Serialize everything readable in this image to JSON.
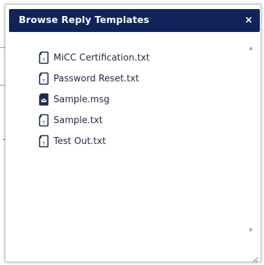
{
  "dialog": {
    "title": "Browse Reply Templates",
    "close_label": "×"
  },
  "files": [
    {
      "name": "MiCC Certification.txt",
      "icon": "text-file-icon"
    },
    {
      "name": "Password Reset.txt",
      "icon": "text-file-icon"
    },
    {
      "name": "Sample.msg",
      "icon": "message-file-icon"
    },
    {
      "name": "Sample.txt",
      "icon": "text-file-icon"
    },
    {
      "name": "Test Out.txt",
      "icon": "text-file-icon"
    }
  ],
  "scrollbar": {
    "up_arrow": "▲",
    "down_arrow": "▼"
  },
  "colors": {
    "titlebar": "#10245a",
    "title_text": "#ffffff",
    "file_text": "#222a44"
  }
}
